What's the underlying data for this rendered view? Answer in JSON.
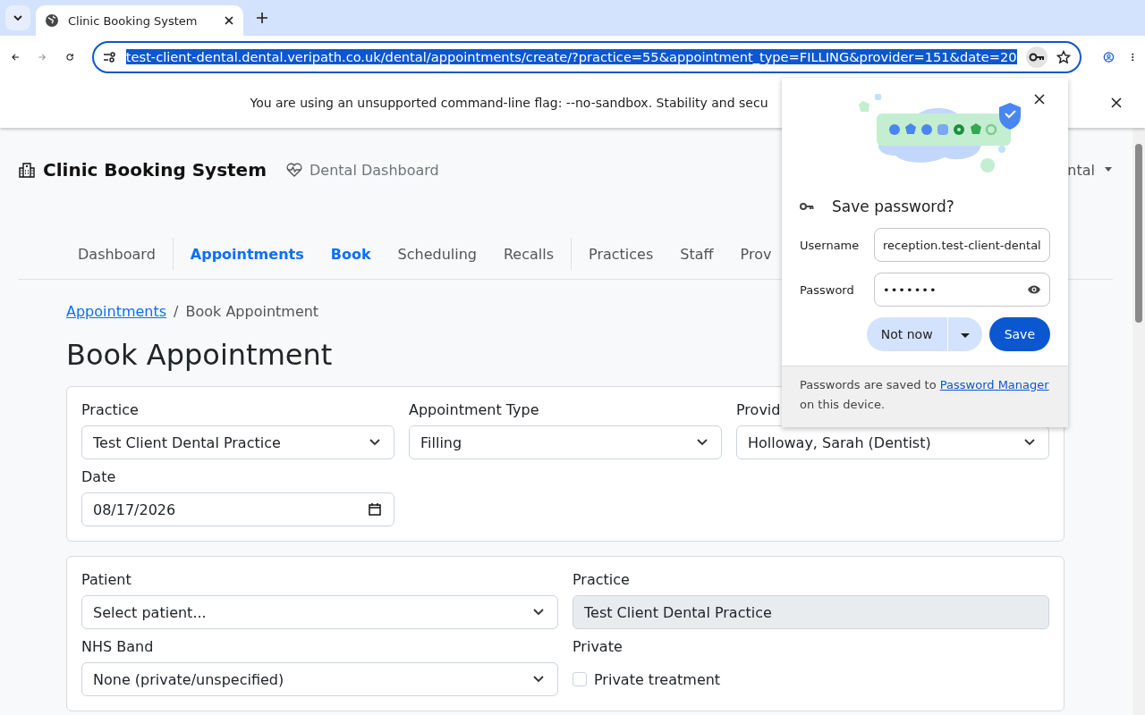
{
  "browser": {
    "tabs": [
      {
        "title": "Clinic Booking System",
        "selected": true
      }
    ],
    "url": "test-client-dental.dental.veripath.co.uk/dental/appointments/create/?practice=55&appointment_type=FILLING&provider=151&date=20",
    "infobar": "You are using an unsupported command-line flag: --no-sandbox. Stability and secu"
  },
  "header": {
    "brand": "Clinic Booking System",
    "dashboard_link": "Dental Dashboard",
    "user_menu": "ntal"
  },
  "nav_groups": [
    [
      {
        "label": "Dashboard",
        "active": false
      }
    ],
    [
      {
        "label": "Appointments",
        "active": true
      },
      {
        "label": "Book",
        "active": true
      },
      {
        "label": "Scheduling",
        "active": false
      },
      {
        "label": "Recalls",
        "active": false
      }
    ],
    [
      {
        "label": "Practices",
        "active": false
      },
      {
        "label": "Staff",
        "active": false
      },
      {
        "label": "Prov",
        "active": false
      }
    ]
  ],
  "breadcrumb": {
    "link": "Appointments",
    "separator": "/",
    "current": "Book Appointment"
  },
  "title": "Book Appointment",
  "cards": [
    {
      "fields": [
        {
          "kind": "select",
          "label": "Practice",
          "value": "Test Client Dental Practice"
        },
        {
          "kind": "select",
          "label": "Appointment Type",
          "value": "Filling"
        },
        {
          "kind": "select",
          "label": "Provid",
          "value": "Holloway, Sarah (Dentist)"
        },
        {
          "kind": "date",
          "label": "Date",
          "value": "08/17/2026"
        }
      ]
    },
    {
      "fields": [
        {
          "kind": "select",
          "label": "Patient",
          "value": "Select patient..."
        },
        {
          "kind": "readonly",
          "label": "Practice",
          "value": "Test Client Dental Practice"
        },
        {
          "kind": "select",
          "label": "NHS Band",
          "value": "None (private/unspecified)"
        },
        {
          "kind": "checkbox",
          "label": "Private",
          "value": "Private treatment",
          "checked": false
        }
      ]
    }
  ],
  "password_popup": {
    "title": "Save password?",
    "username_label": "Username",
    "username": "reception.test-client-dental",
    "password_label": "Password",
    "password": "•••••••",
    "not_now": "Not now",
    "save": "Save",
    "footer": "Passwords are saved to ",
    "footer_link": "Password Manager",
    "footer_end": " on this device."
  }
}
